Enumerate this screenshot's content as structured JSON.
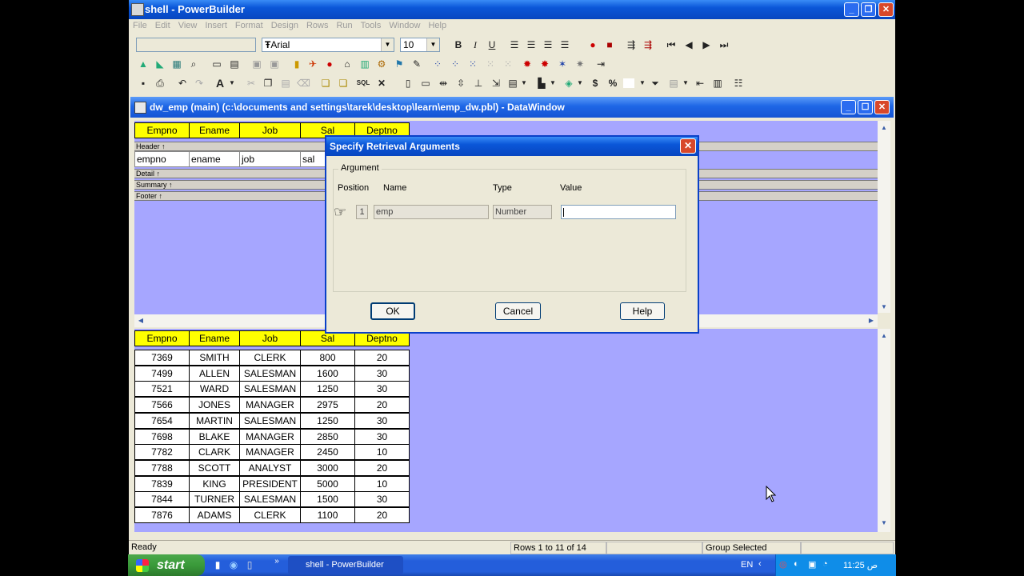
{
  "window": {
    "title": "shell - PowerBuilder"
  },
  "menu": [
    "File",
    "Edit",
    "View",
    "Insert",
    "Format",
    "Design",
    "Rows",
    "Run",
    "Tools",
    "Window",
    "Help"
  ],
  "toolbar": {
    "font_name": "Arial",
    "font_size": "10",
    "bold": "B",
    "italic": "I",
    "underline": "U",
    "text_tool": "A",
    "sql_tool": "SQL",
    "currency": "$",
    "percent": "%"
  },
  "datawindow": {
    "title": "dw_emp  (main) (c:\\documents and settings\\tarek\\desktop\\learn\\emp_dw.pbl) - DataWindow",
    "headers": [
      "Empno",
      "Ename",
      "Job",
      "Sal",
      "Deptno"
    ],
    "bands": {
      "header": "Header ↑",
      "detail": "Detail ↑",
      "summary": "Summary ↑",
      "footer": "Footer ↑"
    },
    "detail_fields": [
      "empno",
      "ename",
      "job",
      "sal"
    ],
    "rows": [
      [
        "7369",
        "SMITH",
        "CLERK",
        "800",
        "20"
      ],
      [
        "7499",
        "ALLEN",
        "SALESMAN",
        "1600",
        "30"
      ],
      [
        "7521",
        "WARD",
        "SALESMAN",
        "1250",
        "30"
      ],
      [
        "7566",
        "JONES",
        "MANAGER",
        "2975",
        "20"
      ],
      [
        "7654",
        "MARTIN",
        "SALESMAN",
        "1250",
        "30"
      ],
      [
        "7698",
        "BLAKE",
        "MANAGER",
        "2850",
        "30"
      ],
      [
        "7782",
        "CLARK",
        "MANAGER",
        "2450",
        "10"
      ],
      [
        "7788",
        "SCOTT",
        "ANALYST",
        "3000",
        "20"
      ],
      [
        "7839",
        "KING",
        "PRESIDENT",
        "5000",
        "10"
      ],
      [
        "7844",
        "TURNER",
        "SALESMAN",
        "1500",
        "30"
      ],
      [
        "7876",
        "ADAMS",
        "CLERK",
        "1100",
        "20"
      ]
    ]
  },
  "dialog": {
    "title": "Specify Retrieval Arguments",
    "group_label": "Argument",
    "col_position": "Position",
    "col_name": "Name",
    "col_type": "Type",
    "col_value": "Value",
    "arg_position": "1",
    "arg_name": "emp",
    "arg_type": "Number",
    "arg_value": "",
    "ok": "OK",
    "cancel": "Cancel",
    "help": "Help"
  },
  "status": {
    "ready": "Ready",
    "rows": "Rows 1 to 11 of 14",
    "selection": "Group Selected"
  },
  "taskbar": {
    "start": "start",
    "task": "shell - PowerBuilder",
    "language": "EN",
    "clock": "11:25 ص"
  }
}
